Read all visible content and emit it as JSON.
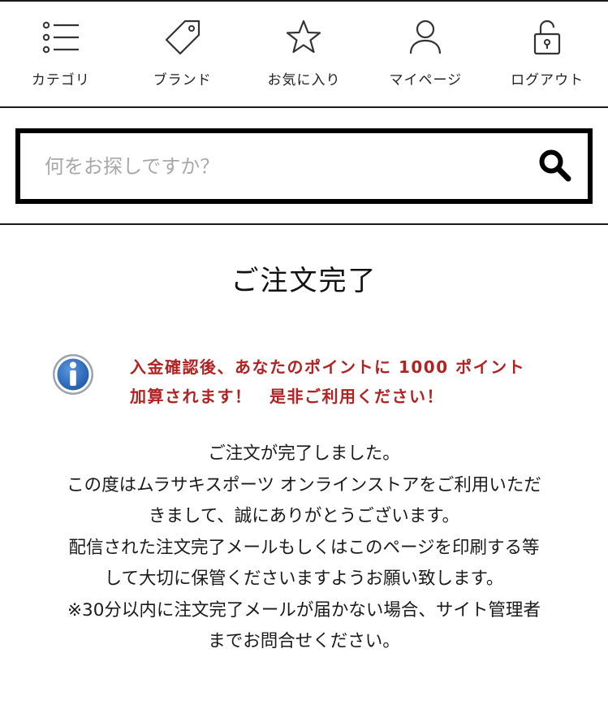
{
  "nav": {
    "items": [
      {
        "label": "カテゴリ",
        "icon": "list-icon"
      },
      {
        "label": "ブランド",
        "icon": "tag-icon"
      },
      {
        "label": "お気に入り",
        "icon": "star-icon"
      },
      {
        "label": "マイページ",
        "icon": "user-icon"
      },
      {
        "label": "ログアウト",
        "icon": "unlock-icon"
      }
    ]
  },
  "search": {
    "placeholder": "何をお探しですか？",
    "value": ""
  },
  "page": {
    "title": "ご注文完了"
  },
  "notice": {
    "lines": [
      "入金確認後、あなたのポイントに 1000 ポイント",
      "加算されます！　是非ご利用ください！"
    ],
    "color": "#b22222"
  },
  "message": {
    "lines": [
      "ご注文が完了しました。",
      "この度はムラサキスポーツ オンラインストアをご利用いただ",
      "きまして、誠にありがとうございます。",
      "配信された注文完了メールもしくはこのページを印刷する等",
      "して大切に保管くださいますようお願い致します。",
      "※30分以内に注文完了メールが届かない場合、サイト管理者",
      "までお問合せください。"
    ]
  },
  "colors": {
    "info_icon_blue": "#2f6fc1"
  }
}
